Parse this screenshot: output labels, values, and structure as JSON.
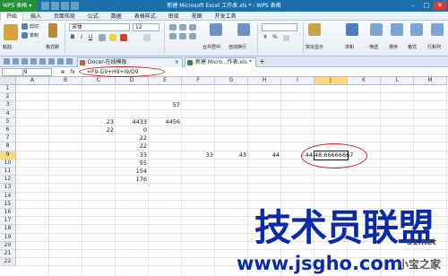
{
  "titlebar": {
    "app_button": "WPS 表格",
    "title": "新建 Microsoft Excel 工作表.xls * - WPS 表格",
    "minimize": "–",
    "maximize": "□",
    "close": "✕"
  },
  "menu": [
    "开始",
    "插入",
    "页面布局",
    "公式",
    "数据",
    "表格样式",
    "审阅",
    "视图",
    "开发工具"
  ],
  "ribbon": {
    "cut": "剪切",
    "copy": "复制",
    "format_painter": "格式刷",
    "paste": "粘贴",
    "font_name": "宋体",
    "font_size": "12",
    "bold": "B",
    "italic": "I",
    "underline": "U",
    "merge_center": "合并居中",
    "wrap_text": "自动换行",
    "percent": "%",
    "conditional_format": "突出显示",
    "sum": "求和",
    "filter": "筛选",
    "sort": "排序",
    "format": "格式",
    "row_col": "行和列"
  },
  "tabs": [
    {
      "label": "Docer-在线模板"
    },
    {
      "label": "新建 Micro...作表.xls *"
    }
  ],
  "formula_bar": {
    "name_box": "J9",
    "formula": "=F9-G9+H9+I9/D9"
  },
  "columns": [
    "A",
    "B",
    "C",
    "D",
    "E",
    "F",
    "G",
    "H",
    "I",
    "J",
    "K",
    "L",
    "M"
  ],
  "selected_column": "J",
  "rows": [
    "1",
    "2",
    "3",
    "4",
    "5",
    "6",
    "7",
    "8",
    "9",
    "10",
    "11",
    "12",
    "13",
    "14",
    "15",
    "16",
    "17",
    "18",
    "19",
    "20",
    "21",
    "22"
  ],
  "selected_row": "9",
  "cells": {
    "E3": "57",
    "C5": "23",
    "D5": "4433",
    "E5": "4456",
    "C6": "22",
    "D6": "0",
    "D7": "22",
    "D8": "22",
    "D9": "33",
    "F9": "33",
    "G9": "43",
    "H9": "44",
    "I9": "44",
    "J9": "48.66666667",
    "D10": "55",
    "D11": "154",
    "D12": "176"
  },
  "watermark": {
    "main": "技术员联盟",
    "url": "www.jsgho.com",
    "side": "51.net",
    "corner": "小宝之家"
  },
  "colors": {
    "titlebar": "#1a6ea9",
    "app_button": "#2a8f3c",
    "annotation_ring": "#d01818",
    "selected_header": "#ffd87a",
    "watermark": "#0a2aa8"
  }
}
